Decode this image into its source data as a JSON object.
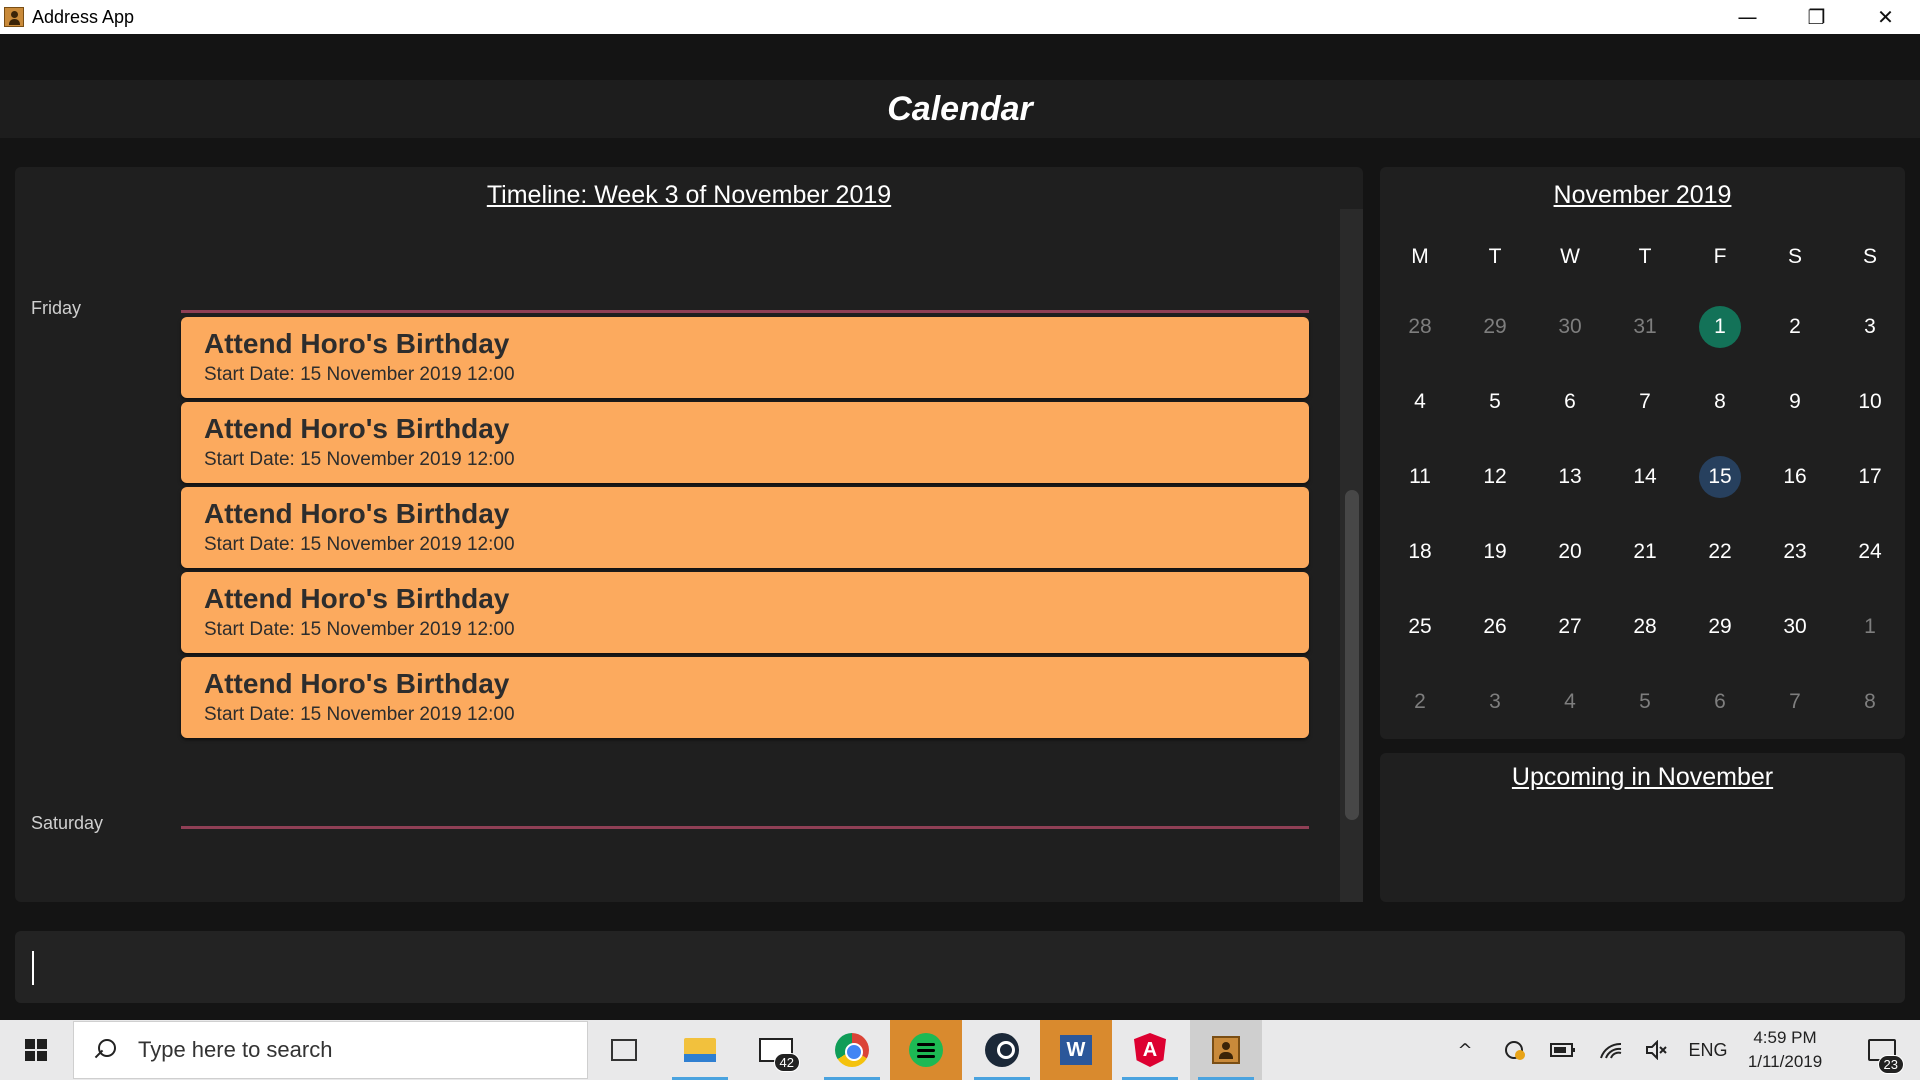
{
  "window": {
    "title": "Address App",
    "minimize_glyph": "—",
    "restore_glyph": "❐",
    "close_glyph": "✕"
  },
  "header": {
    "title": "Calendar"
  },
  "timeline": {
    "title": "Timeline: Week 3 of November 2019",
    "days": [
      {
        "label": "Friday"
      },
      {
        "label": "Saturday"
      }
    ],
    "events": [
      {
        "title": "Attend Horo's Birthday",
        "start": "Start Date: 15 November 2019 12:00"
      },
      {
        "title": "Attend Horo's Birthday",
        "start": "Start Date: 15 November 2019 12:00"
      },
      {
        "title": "Attend Horo's Birthday",
        "start": "Start Date: 15 November 2019 12:00"
      },
      {
        "title": "Attend Horo's Birthday",
        "start": "Start Date: 15 November 2019 12:00"
      },
      {
        "title": "Attend Horo's Birthday",
        "start": "Start Date: 15 November 2019 12:00"
      }
    ],
    "event_color": "#fcaa5e",
    "day_line_color": "#8f3f55"
  },
  "calendar": {
    "title": "November 2019",
    "weekdays": [
      "M",
      "T",
      "W",
      "T",
      "F",
      "S",
      "S"
    ],
    "weeks": [
      [
        {
          "d": "28",
          "muted": true
        },
        {
          "d": "29",
          "muted": true
        },
        {
          "d": "30",
          "muted": true
        },
        {
          "d": "31",
          "muted": true
        },
        {
          "d": "1",
          "today": true
        },
        {
          "d": "2"
        },
        {
          "d": "3"
        }
      ],
      [
        {
          "d": "4"
        },
        {
          "d": "5"
        },
        {
          "d": "6"
        },
        {
          "d": "7"
        },
        {
          "d": "8"
        },
        {
          "d": "9"
        },
        {
          "d": "10"
        }
      ],
      [
        {
          "d": "11"
        },
        {
          "d": "12"
        },
        {
          "d": "13"
        },
        {
          "d": "14"
        },
        {
          "d": "15",
          "selected": true
        },
        {
          "d": "16"
        },
        {
          "d": "17"
        }
      ],
      [
        {
          "d": "18"
        },
        {
          "d": "19"
        },
        {
          "d": "20"
        },
        {
          "d": "21"
        },
        {
          "d": "22"
        },
        {
          "d": "23"
        },
        {
          "d": "24"
        }
      ],
      [
        {
          "d": "25"
        },
        {
          "d": "26"
        },
        {
          "d": "27"
        },
        {
          "d": "28"
        },
        {
          "d": "29"
        },
        {
          "d": "30"
        },
        {
          "d": "1",
          "muted": true
        }
      ],
      [
        {
          "d": "2",
          "muted": true
        },
        {
          "d": "3",
          "muted": true
        },
        {
          "d": "4",
          "muted": true
        },
        {
          "d": "5",
          "muted": true
        },
        {
          "d": "6",
          "muted": true
        },
        {
          "d": "7",
          "muted": true
        },
        {
          "d": "8",
          "muted": true
        }
      ]
    ],
    "today_color": "#137258",
    "selected_color": "#27405e"
  },
  "upcoming": {
    "title": "Upcoming in November"
  },
  "command": {
    "value": "",
    "placeholder": ""
  },
  "taskbar": {
    "search_placeholder": "Type here to search",
    "mail_badge": "42",
    "word_letter": "W",
    "angular_letter": "A",
    "tray": {
      "chevron": "^",
      "language": "ENG",
      "time": "4:59 PM",
      "date": "1/11/2019",
      "notifications": "23"
    }
  }
}
